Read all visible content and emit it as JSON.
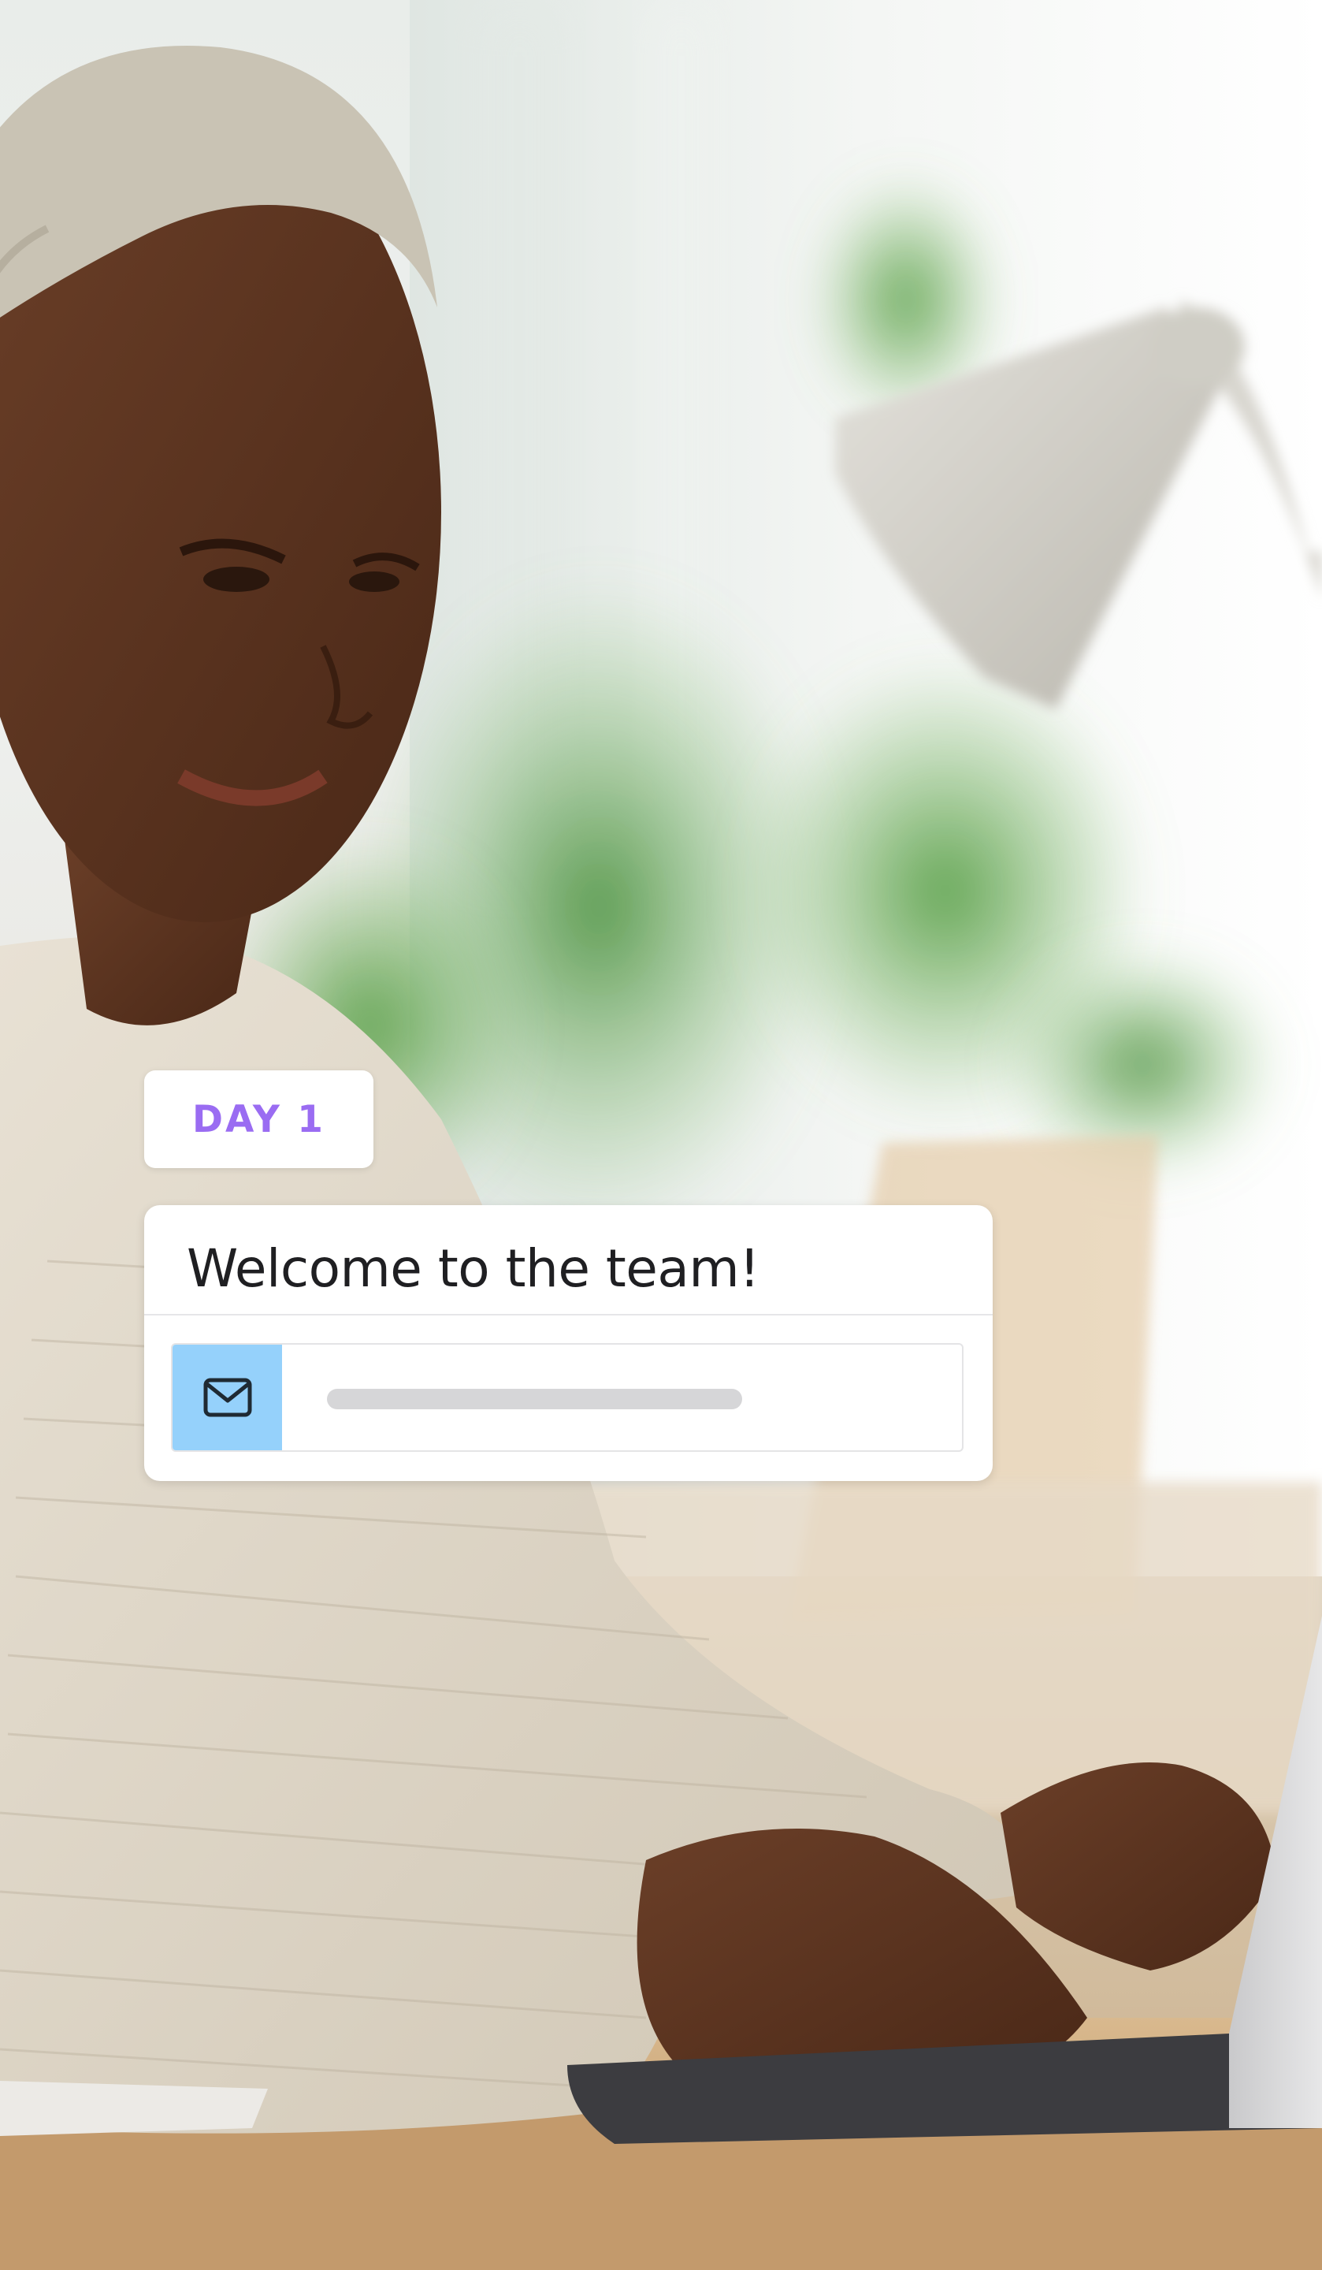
{
  "badge": {
    "label": "DAY 1"
  },
  "card": {
    "title": "Welcome to the team!",
    "message_icon": "envelope-icon",
    "message_preview_progress": 0.55
  },
  "colors": {
    "badge_text": "#9a6cf2",
    "icon_tile": "#95d1fb",
    "card_bg": "#ffffff",
    "title_text": "#1f1f22",
    "placeholder": "#d6d6d8"
  },
  "scene": {
    "description_icon": "photo-background"
  }
}
